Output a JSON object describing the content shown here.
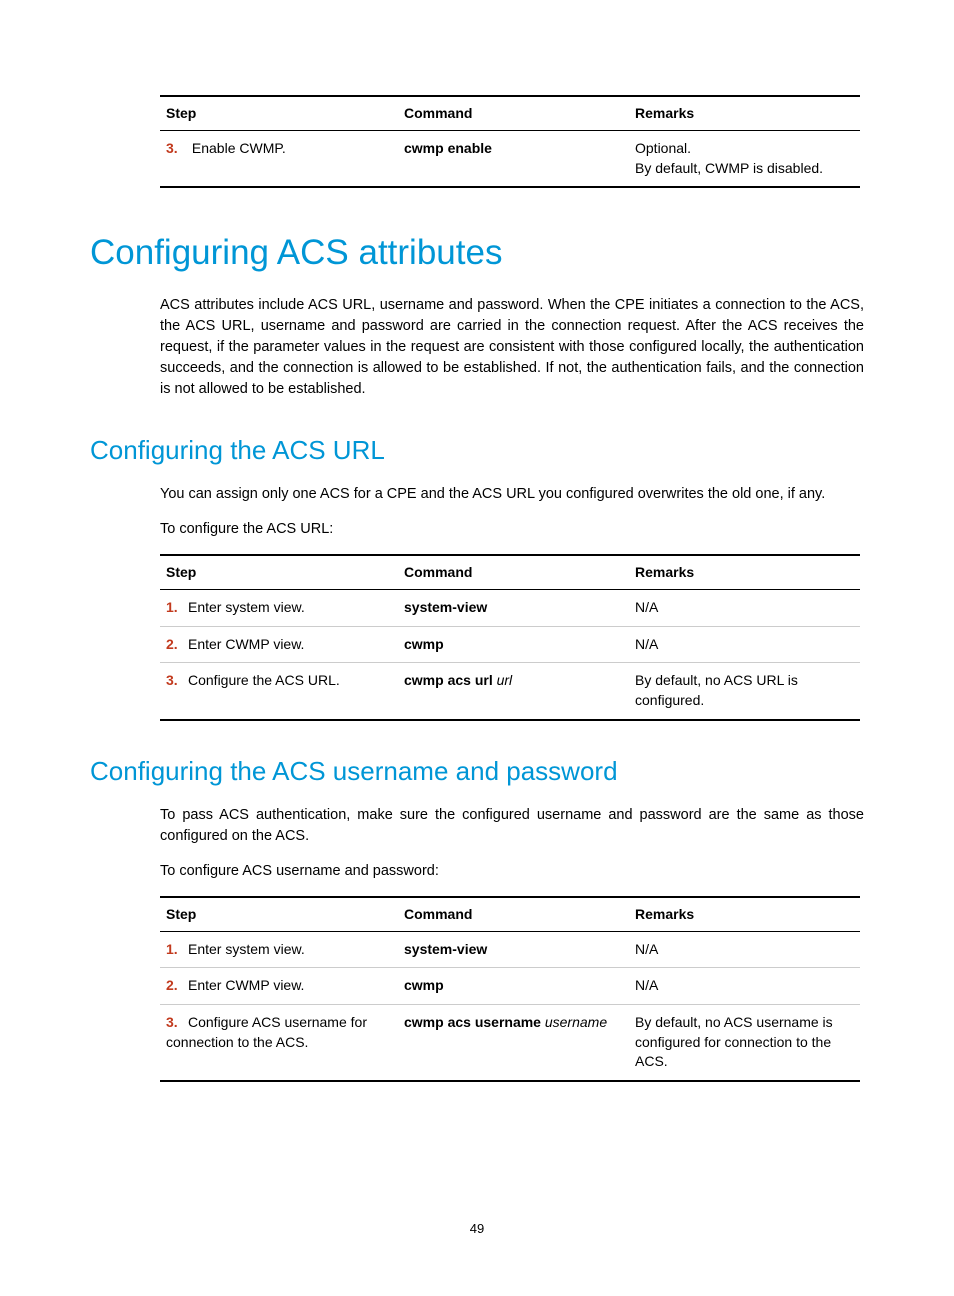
{
  "table1": {
    "headers": {
      "step": "Step",
      "command": "Command",
      "remarks": "Remarks"
    },
    "rows": [
      {
        "num": "3.",
        "step": "Enable CWMP.",
        "command": "cwmp enable",
        "remarks_line1": "Optional.",
        "remarks_line2": "By default, CWMP is disabled."
      }
    ]
  },
  "h1_1": "Configuring ACS attributes",
  "p1": "ACS attributes include ACS URL, username and password. When the CPE initiates a connection to the ACS, the ACS URL, username and password are carried in the connection request. After the ACS receives the request, if the parameter values in the request are consistent with those configured locally, the authentication succeeds, and the connection is allowed to be established. If not, the authentication fails, and the connection is not allowed to be established.",
  "h2_1": "Configuring the ACS URL",
  "p2": "You can assign only one ACS for a CPE and the ACS URL you configured overwrites the old one, if any.",
  "p3": "To configure the ACS URL:",
  "table2": {
    "headers": {
      "step": "Step",
      "command": "Command",
      "remarks": "Remarks"
    },
    "rows": [
      {
        "num": "1.",
        "step": "Enter system view.",
        "cmd_bold": "system-view",
        "cmd_italic": "",
        "remarks": "N/A"
      },
      {
        "num": "2.",
        "step": "Enter CWMP view.",
        "cmd_bold": "cwmp",
        "cmd_italic": "",
        "remarks": "N/A"
      },
      {
        "num": "3.",
        "step": "Configure the ACS URL.",
        "cmd_bold": "cwmp acs url",
        "cmd_italic": " url",
        "remarks": "By default, no ACS URL is configured."
      }
    ]
  },
  "h2_2": "Configuring the ACS username and password",
  "p4": "To pass ACS authentication, make sure the configured username and password are the same as those configured on the ACS.",
  "p5": "To configure ACS username and password:",
  "table3": {
    "headers": {
      "step": "Step",
      "command": "Command",
      "remarks": "Remarks"
    },
    "rows": [
      {
        "num": "1.",
        "step": "Enter system view.",
        "cmd_bold": "system-view",
        "cmd_italic": "",
        "remarks": "N/A"
      },
      {
        "num": "2.",
        "step": "Enter CWMP view.",
        "cmd_bold": "cwmp",
        "cmd_italic": "",
        "remarks": "N/A"
      },
      {
        "num": "3.",
        "step": "Configure ACS username for connection to the ACS.",
        "cmd_bold": "cwmp acs username",
        "cmd_italic": " username",
        "remarks": "By default, no ACS username is configured for connection to the ACS."
      }
    ]
  },
  "page_number": "49"
}
